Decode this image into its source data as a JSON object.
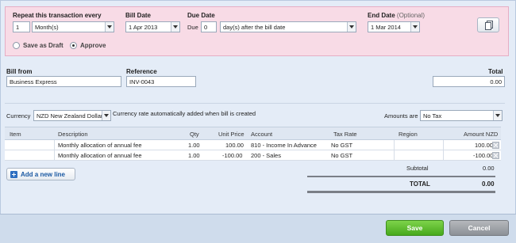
{
  "recurrence": {
    "repeat_label": "Repeat this transaction every",
    "repeat_count": "1",
    "repeat_unit": "Month(s)",
    "bill_date_label": "Bill Date",
    "bill_date": "1 Apr 2013",
    "due_date_label": "Due Date",
    "due_prefix": "Due",
    "due_value": "0",
    "due_rule": "day(s) after the bill date",
    "end_date_label": "End Date",
    "end_date_optional": "(Optional)",
    "end_date": "1 Mar 2014",
    "save_as_draft_label": "Save as Draft",
    "approve_label": "Approve",
    "selected_option": "Approve"
  },
  "bill": {
    "bill_from_label": "Bill from",
    "bill_from": "Business Express",
    "reference_label": "Reference",
    "reference": "INV-0043",
    "total_label": "Total",
    "total": "0.00"
  },
  "currency": {
    "label": "Currency",
    "value": "NZD New Zealand Dollar",
    "note": "Currency rate automatically added when bill is created",
    "amounts_are_label": "Amounts are",
    "amounts_are": "No Tax"
  },
  "table": {
    "columns": [
      "Item",
      "Description",
      "Qty",
      "Unit Price",
      "Account",
      "Tax Rate",
      "Region",
      "Amount NZD"
    ],
    "rows": [
      {
        "item": "",
        "description": "Monthly allocation of annual fee",
        "qty": "1.00",
        "unit_price": "100.00",
        "account": "810 - Income In Advance",
        "tax_rate": "No GST",
        "region": "",
        "amount": "100.00"
      },
      {
        "item": "",
        "description": "Monthly allocation of annual fee",
        "qty": "1.00",
        "unit_price": "-100.00",
        "account": "200 - Sales",
        "tax_rate": "No GST",
        "region": "",
        "amount": "-100.00"
      }
    ]
  },
  "add_line_label": "Add a new line",
  "totals": {
    "subtotal_label": "Subtotal",
    "subtotal": "0.00",
    "total_label": "TOTAL",
    "total": "0.00"
  },
  "actions": {
    "save_label": "Save",
    "cancel_label": "Cancel"
  },
  "colors": {
    "recurrence_panel": "#f8dbe6",
    "save_button": "#47a91c",
    "cancel_button": "#8c9096",
    "link": "#1c5aa3"
  }
}
